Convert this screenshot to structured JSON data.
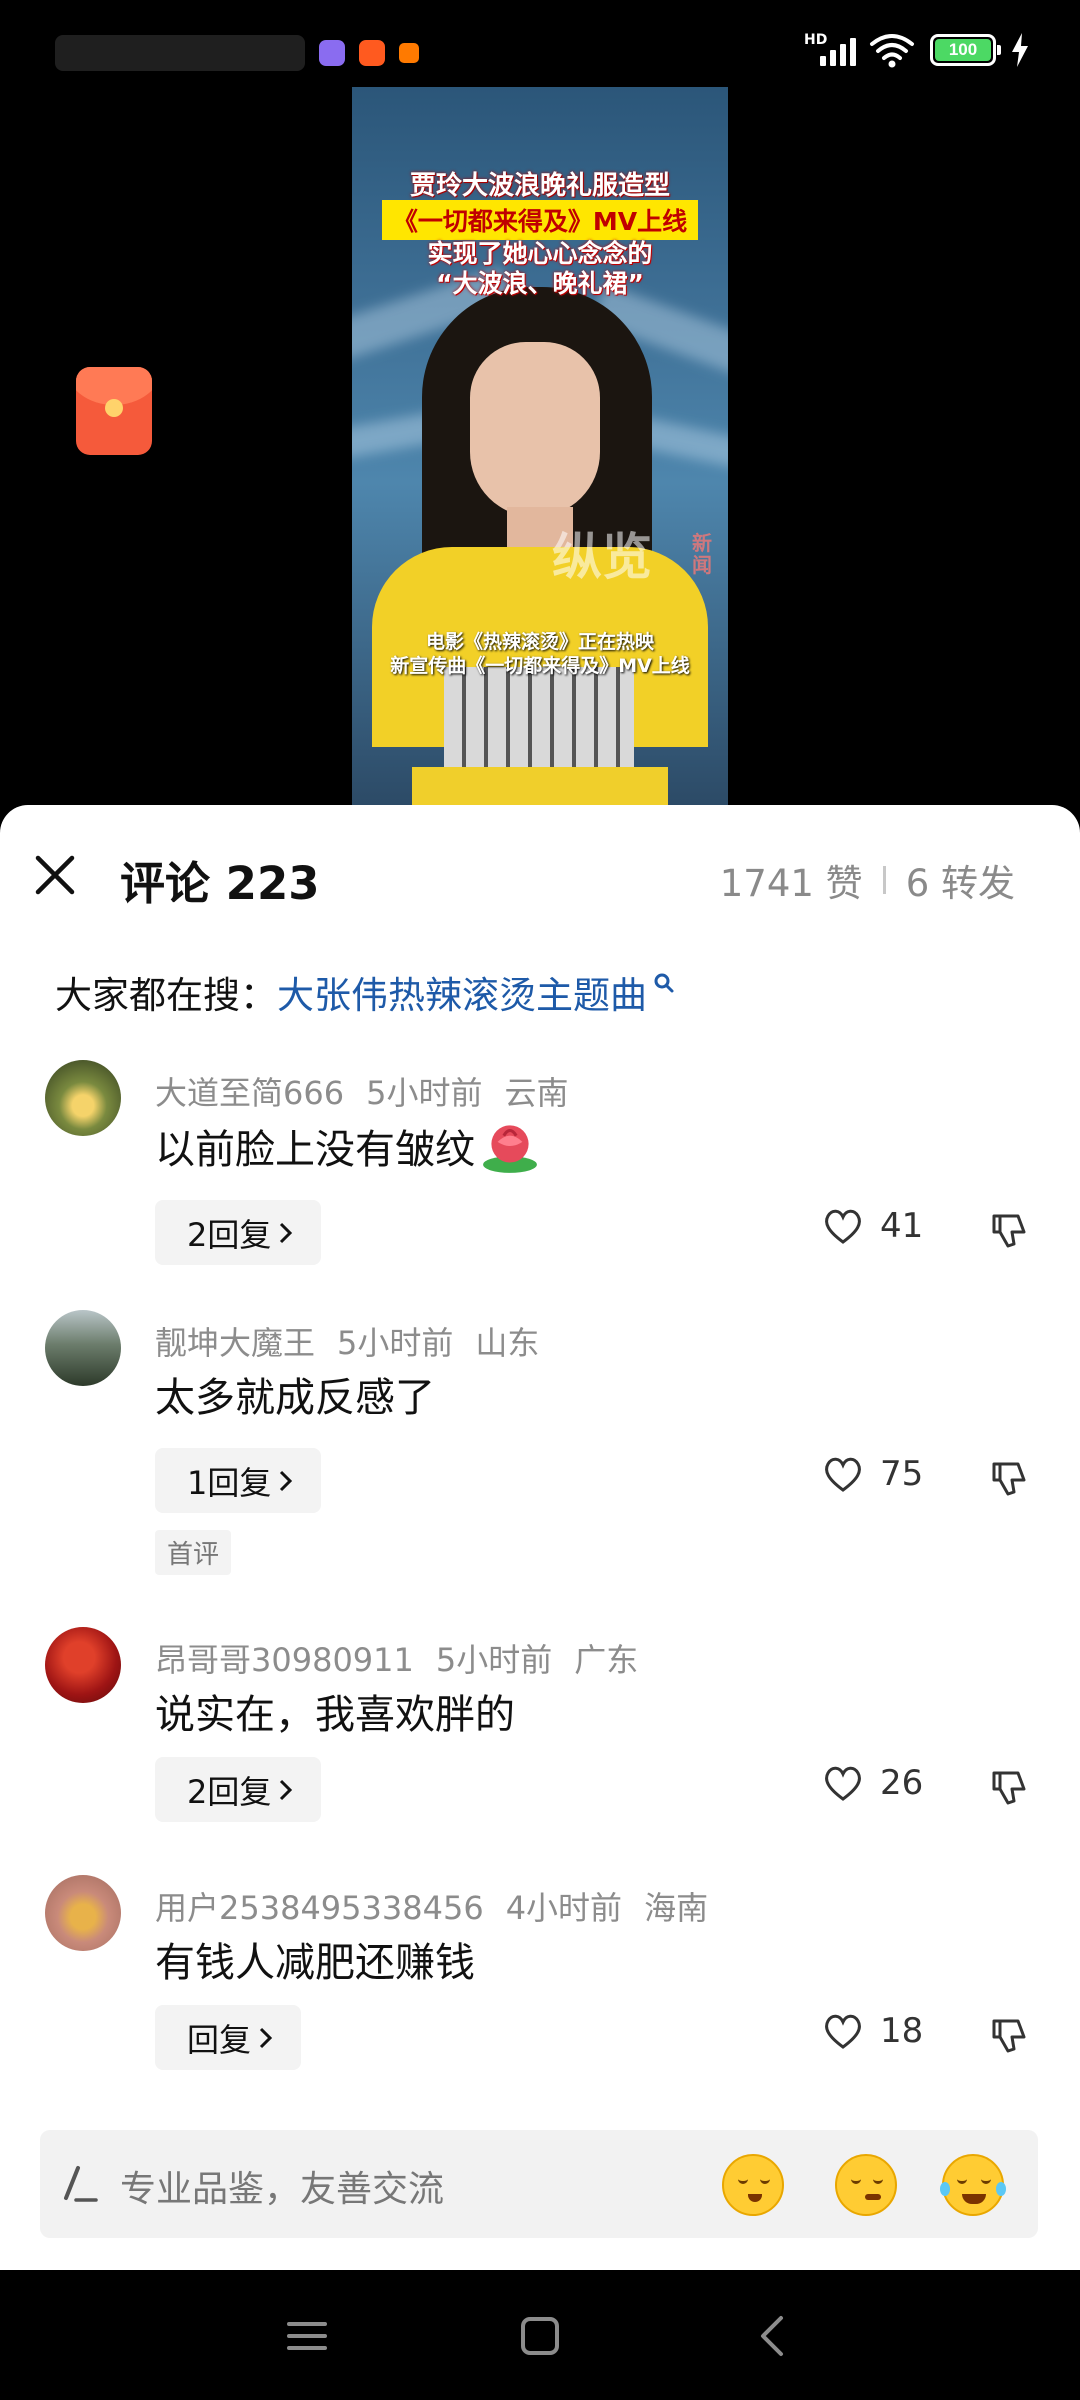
{
  "status_bar": {
    "network_label": "HD",
    "battery": "100",
    "app_icon_colors": [
      "#8a6cf0",
      "#ff5a1f",
      "#ff7a00"
    ]
  },
  "video": {
    "title_line1": "贾玲大波浪晚礼服造型",
    "title_line2": "《一切都来得及》MV上线",
    "title_line3a": "实现了她心心念念的",
    "title_line3b": "“大波浪、晚礼裙”",
    "watermark": "纵览",
    "watermark_small": "新闻",
    "subtitle_line1": "电影《热辣滚烫》正在热映",
    "subtitle_line2": "新宣传曲《一切都来得及》MV上线"
  },
  "sheet": {
    "title": "评论 223",
    "likes": "1741 赞",
    "reposts": "6 转发"
  },
  "search": {
    "label": "大家都在搜：",
    "term": "大张伟热辣滚烫主题曲"
  },
  "comments": [
    {
      "user": "大道至简666",
      "time": "5小时前",
      "location": "云南",
      "text": "以前脸上没有皱纹",
      "reply_label": "2回复",
      "likes": "41",
      "avatar_color": "#6f7b45"
    },
    {
      "user": "靓坤大魔王",
      "time": "5小时前",
      "location": "山东",
      "text": "太多就成反感了",
      "reply_label": "1回复",
      "likes": "75",
      "tag": "首评",
      "avatar_color": "#4f5d4a"
    },
    {
      "user": "昂哥哥30980911",
      "time": "5小时前",
      "location": "广东",
      "text": "说实在，我喜欢胖的",
      "reply_label": "2回复",
      "likes": "26",
      "avatar_color": "#b21d1d"
    },
    {
      "user": "用户2538495338456",
      "time": "4小时前",
      "location": "海南",
      "text": "有钱人减肥还赚钱",
      "reply_label": "回复",
      "likes": "18",
      "avatar_color": "#c98a7a"
    }
  ],
  "input": {
    "placeholder": "专业品鉴，友善交流"
  },
  "icons": {
    "close": "close-icon",
    "search": "search-icon",
    "like": "heart-icon",
    "dislike": "thumbs-down-icon",
    "pen": "pen-icon",
    "menu": "menu-icon",
    "home": "home-icon",
    "back": "back-icon"
  }
}
